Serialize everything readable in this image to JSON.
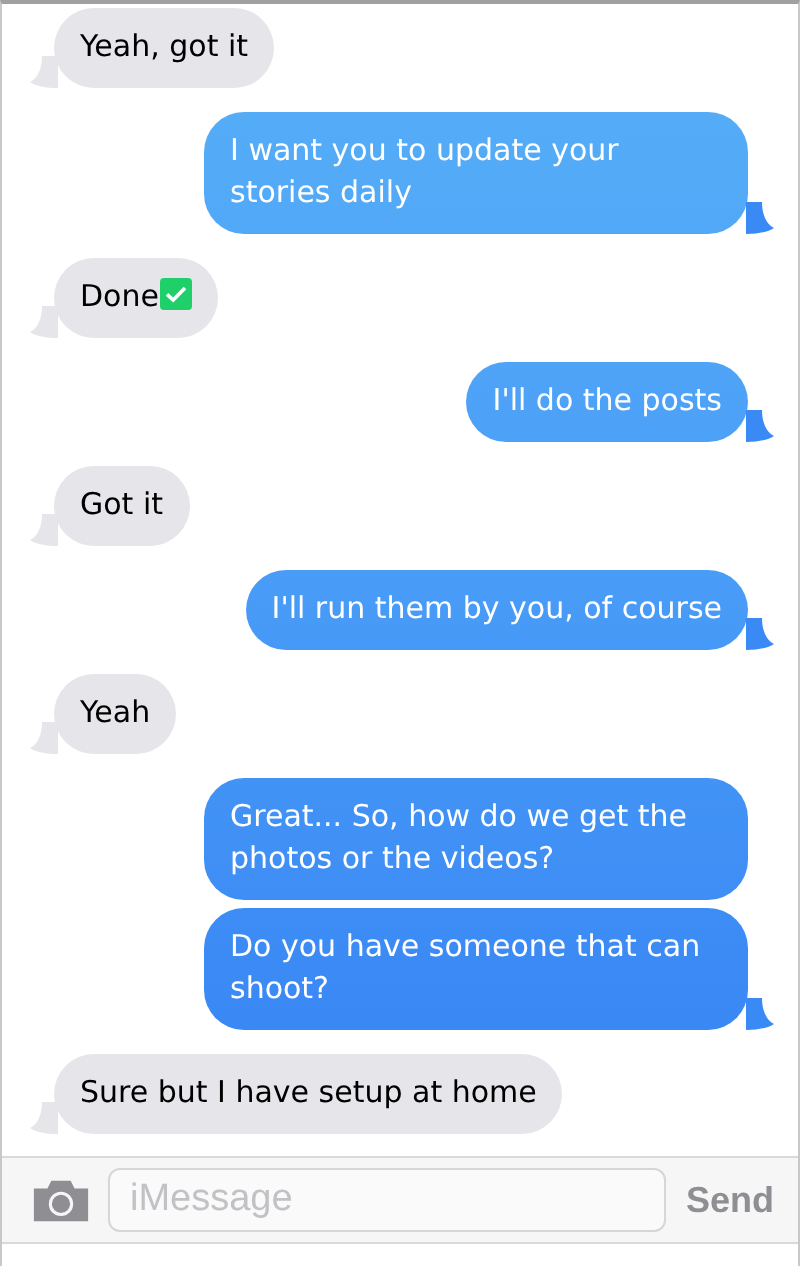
{
  "messages": [
    {
      "kind": "incoming",
      "check": false,
      "text": "Yeah, got it"
    },
    {
      "kind": "outgoing",
      "check": false,
      "text": "I want you to update your stories daily"
    },
    {
      "kind": "incoming",
      "check": true,
      "text": "Done"
    },
    {
      "kind": "outgoing",
      "check": false,
      "text": "I'll do the posts"
    },
    {
      "kind": "incoming",
      "check": false,
      "text": "Got it"
    },
    {
      "kind": "outgoing",
      "check": false,
      "text": "I'll run them by you, of course"
    },
    {
      "kind": "incoming",
      "check": false,
      "text": "Yeah"
    },
    {
      "kind": "outgoing",
      "check": false,
      "text": "Great... So, how do we get the photos or the videos?"
    },
    {
      "kind": "outgoing",
      "check": false,
      "text": "Do you have someone that can shoot?"
    },
    {
      "kind": "incoming",
      "check": false,
      "text": "Sure but I have setup at home"
    }
  ],
  "composer": {
    "placeholder": "iMessage",
    "send": "Send"
  }
}
